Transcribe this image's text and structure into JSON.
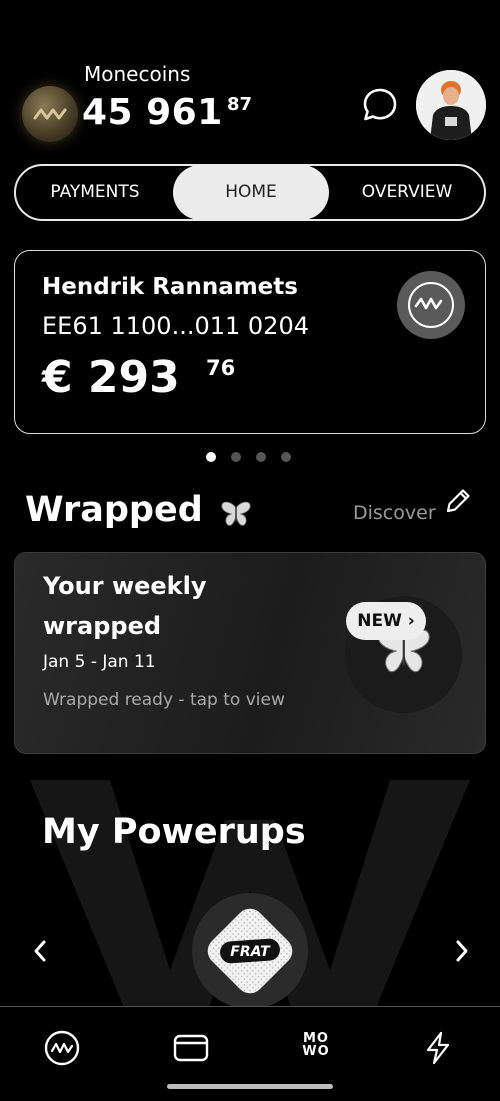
{
  "header": {
    "coins_label": "Monecoins",
    "coins_value": "45 961",
    "coins_cents": "87",
    "chat_icon": "chat-bubble-icon",
    "avatar": "user-avatar"
  },
  "tabs": [
    {
      "label": "PAYMENTS",
      "active": false
    },
    {
      "label": "HOME",
      "active": true
    },
    {
      "label": "OVERVIEW",
      "active": false
    }
  ],
  "account": {
    "name": "Hendrik Rannamets",
    "iban": "EE61 1100...011 0204",
    "balance": "€ 293",
    "balance_cents": "76",
    "logo_icon": "wave-logo-icon",
    "pager": {
      "count": 4,
      "active": 0
    }
  },
  "wrapped": {
    "title": "Wrapped",
    "discover_label": "Discover",
    "card_title": "Your weekly wrapped",
    "dates": "Jan 5 - Jan 11",
    "status": "Wrapped ready - tap to view",
    "badge": "NEW"
  },
  "powerups": {
    "title": "My Powerups",
    "current": "FRAT"
  },
  "bottom_nav": [
    {
      "name": "home",
      "icon": "wave-logo-icon"
    },
    {
      "name": "cards",
      "icon": "card-icon"
    },
    {
      "name": "mowo",
      "label_top": "MO",
      "label_bottom": "WO"
    },
    {
      "name": "powerups",
      "icon": "lightning-icon"
    }
  ],
  "colors": {
    "background": "#000000",
    "tab_active_bg": "#ececec",
    "muted_text": "#a9a9a9"
  }
}
